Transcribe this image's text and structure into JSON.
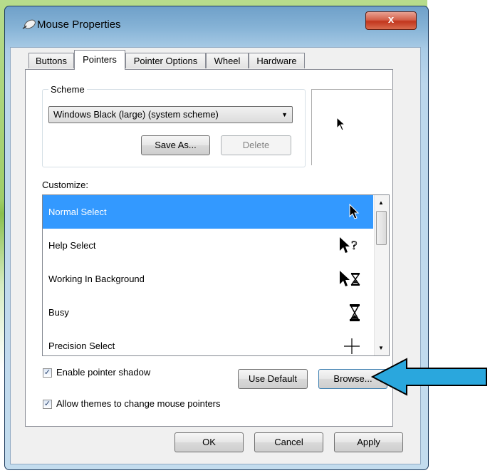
{
  "window": {
    "title": "Mouse Properties",
    "close_label": "x"
  },
  "tabs": [
    {
      "label": "Buttons",
      "active": false
    },
    {
      "label": "Pointers",
      "active": true
    },
    {
      "label": "Pointer Options",
      "active": false
    },
    {
      "label": "Wheel",
      "active": false
    },
    {
      "label": "Hardware",
      "active": false
    }
  ],
  "scheme": {
    "legend": "Scheme",
    "selected": "Windows Black (large) (system scheme)",
    "save_as_label": "Save As...",
    "delete_label": "Delete"
  },
  "customize": {
    "label": "Customize:",
    "items": [
      {
        "label": "Normal Select",
        "icon": "arrow-cursor-icon",
        "selected": true
      },
      {
        "label": "Help Select",
        "icon": "help-cursor-icon",
        "selected": false
      },
      {
        "label": "Working In Background",
        "icon": "working-cursor-icon",
        "selected": false
      },
      {
        "label": "Busy",
        "icon": "hourglass-icon",
        "selected": false
      },
      {
        "label": "Precision Select",
        "icon": "crosshair-icon",
        "selected": false
      }
    ]
  },
  "options": {
    "shadow_label": "Enable pointer shadow",
    "shadow_checked": true,
    "themes_label": "Allow themes to change mouse pointers",
    "themes_checked": true,
    "use_default_label": "Use Default",
    "browse_label": "Browse..."
  },
  "footer": {
    "ok_label": "OK",
    "cancel_label": "Cancel",
    "apply_label": "Apply"
  },
  "colors": {
    "selection": "#3399ff",
    "annotation_arrow": "#2aa7dd",
    "close_button": "#c2361d"
  }
}
